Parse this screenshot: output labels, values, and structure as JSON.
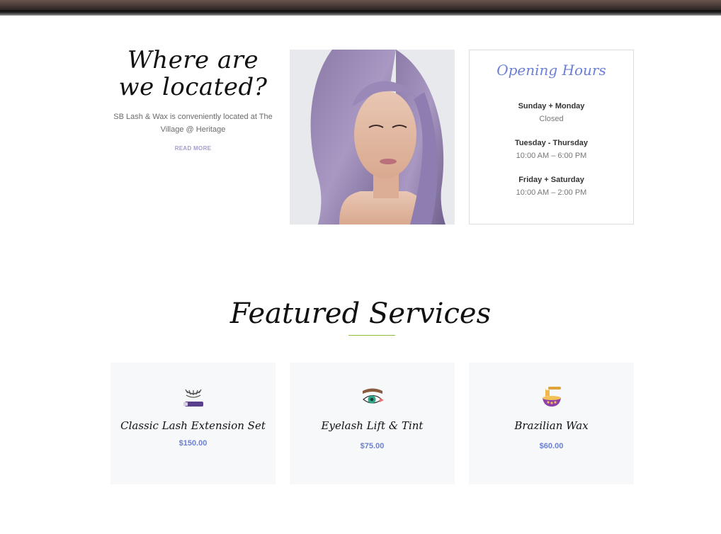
{
  "location": {
    "heading": "Where are we located?",
    "description": "SB Lash & Wax is conveniently located at The Village @ Heritage",
    "read_more": "READ MORE"
  },
  "hours": {
    "title": "Opening Hours",
    "entries": [
      {
        "days": "Sunday + Monday",
        "time": "Closed"
      },
      {
        "days": "Tuesday - Thursday",
        "time": "10:00 AM – 6:00 PM"
      },
      {
        "days": "Friday + Saturday",
        "time": "10:00 AM – 2:00 PM"
      }
    ]
  },
  "featured": {
    "title": "Featured Services",
    "accent_color": "#8dbf3a",
    "services": [
      {
        "name": "Classic Lash Extension Set",
        "price": "$150.00",
        "icon": "lash-extension-icon"
      },
      {
        "name": "Eyelash Lift & Tint",
        "price": "$75.00",
        "icon": "eyelash-lift-icon"
      },
      {
        "name": "Brazilian Wax",
        "price": "$60.00",
        "icon": "wax-bowl-icon"
      }
    ]
  },
  "colors": {
    "brand_blue": "#6b7fd7",
    "read_more_purple": "#a79ad0",
    "card_bg": "#f7f8fa"
  }
}
